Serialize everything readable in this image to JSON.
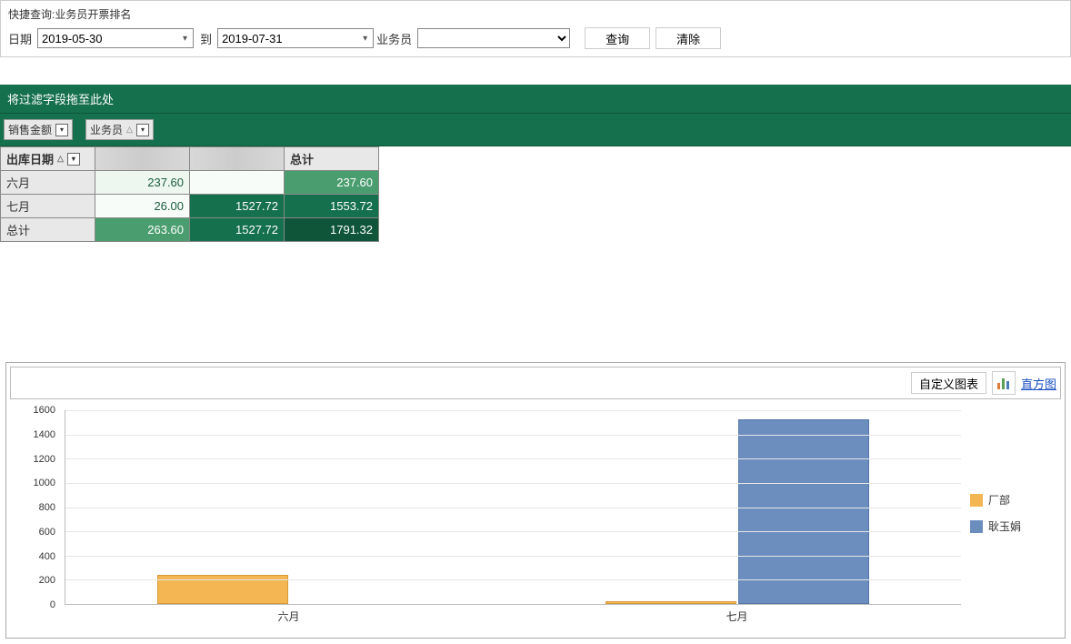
{
  "query": {
    "title": "快捷查询:业务员开票排名",
    "date_label": "日期",
    "date_from": "2019-05-30",
    "to_label": "到",
    "date_to": "2019-07-31",
    "salesman_label": "业务员",
    "salesman_value": "",
    "btn_query": "查询",
    "btn_clear": "清除"
  },
  "pivot": {
    "filter_hint": "将过滤字段拖至此处",
    "measure_chip": "销售金额",
    "col_chip": "业务员",
    "row_chip": "出库日期",
    "col_headers": [
      "",
      "",
      "总计"
    ],
    "rows": [
      {
        "label": "六月",
        "cells": [
          "237.60",
          "",
          "237.60"
        ]
      },
      {
        "label": "七月",
        "cells": [
          "26.00",
          "1527.72",
          "1553.72"
        ]
      },
      {
        "label": "总计",
        "cells": [
          "263.60",
          "1527.72",
          "1791.32"
        ]
      }
    ]
  },
  "chart_toolbar": {
    "custom_btn": "自定义图表",
    "type_link": "直方图"
  },
  "chart_data": {
    "type": "bar",
    "categories": [
      "六月",
      "七月"
    ],
    "series": [
      {
        "name": "厂部",
        "color": "#f4b553",
        "values": [
          237.6,
          26.0
        ]
      },
      {
        "name": "耿玉娟",
        "color": "#6c8ebf",
        "values": [
          0,
          1527.72
        ]
      }
    ],
    "ylim": [
      0,
      1600
    ],
    "y_ticks": [
      0,
      200,
      400,
      600,
      800,
      1000,
      1200,
      1400,
      1600
    ],
    "legend_position": "right"
  }
}
